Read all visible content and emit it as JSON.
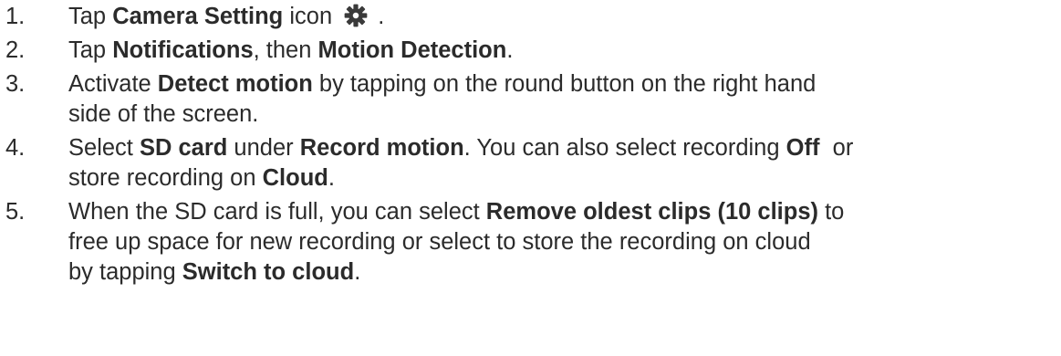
{
  "steps": [
    {
      "number": "1.",
      "lines": [
        [
          {
            "t": "Tap "
          },
          {
            "t": "Camera Setting",
            "b": true
          },
          {
            "t": " icon "
          },
          {
            "icon": "gear-icon"
          },
          {
            "t": " ."
          }
        ]
      ]
    },
    {
      "number": "2.",
      "lines": [
        [
          {
            "t": "Tap "
          },
          {
            "t": "Notifications",
            "b": true
          },
          {
            "t": ", then "
          },
          {
            "t": "Motion Detection",
            "b": true
          },
          {
            "t": "."
          }
        ]
      ]
    },
    {
      "number": "3.",
      "lines": [
        [
          {
            "t": "Activate "
          },
          {
            "t": "Detect motion",
            "b": true
          },
          {
            "t": " by tapping on the round button on the right hand"
          }
        ],
        [
          {
            "t": "side of the screen."
          }
        ]
      ]
    },
    {
      "number": "4.",
      "lines": [
        [
          {
            "t": "Select "
          },
          {
            "t": "SD card",
            "b": true
          },
          {
            "t": " under "
          },
          {
            "t": "Record motion",
            "b": true
          },
          {
            "t": ". You can also select recording "
          },
          {
            "t": "Off",
            "b": true
          },
          {
            "t": "  or"
          }
        ],
        [
          {
            "t": "store recording on "
          },
          {
            "t": "Cloud",
            "b": true
          },
          {
            "t": "."
          }
        ]
      ]
    },
    {
      "number": "5.",
      "lines": [
        [
          {
            "t": "When the SD card is full, you can select "
          },
          {
            "t": "Remove oldest clips (10 clips)",
            "b": true
          },
          {
            "t": " to"
          }
        ],
        [
          {
            "t": "free up space for new recording or select to store the recording on cloud"
          }
        ],
        [
          {
            "t": "by tapping "
          },
          {
            "t": "Switch to cloud",
            "b": true
          },
          {
            "t": "."
          }
        ]
      ]
    }
  ]
}
